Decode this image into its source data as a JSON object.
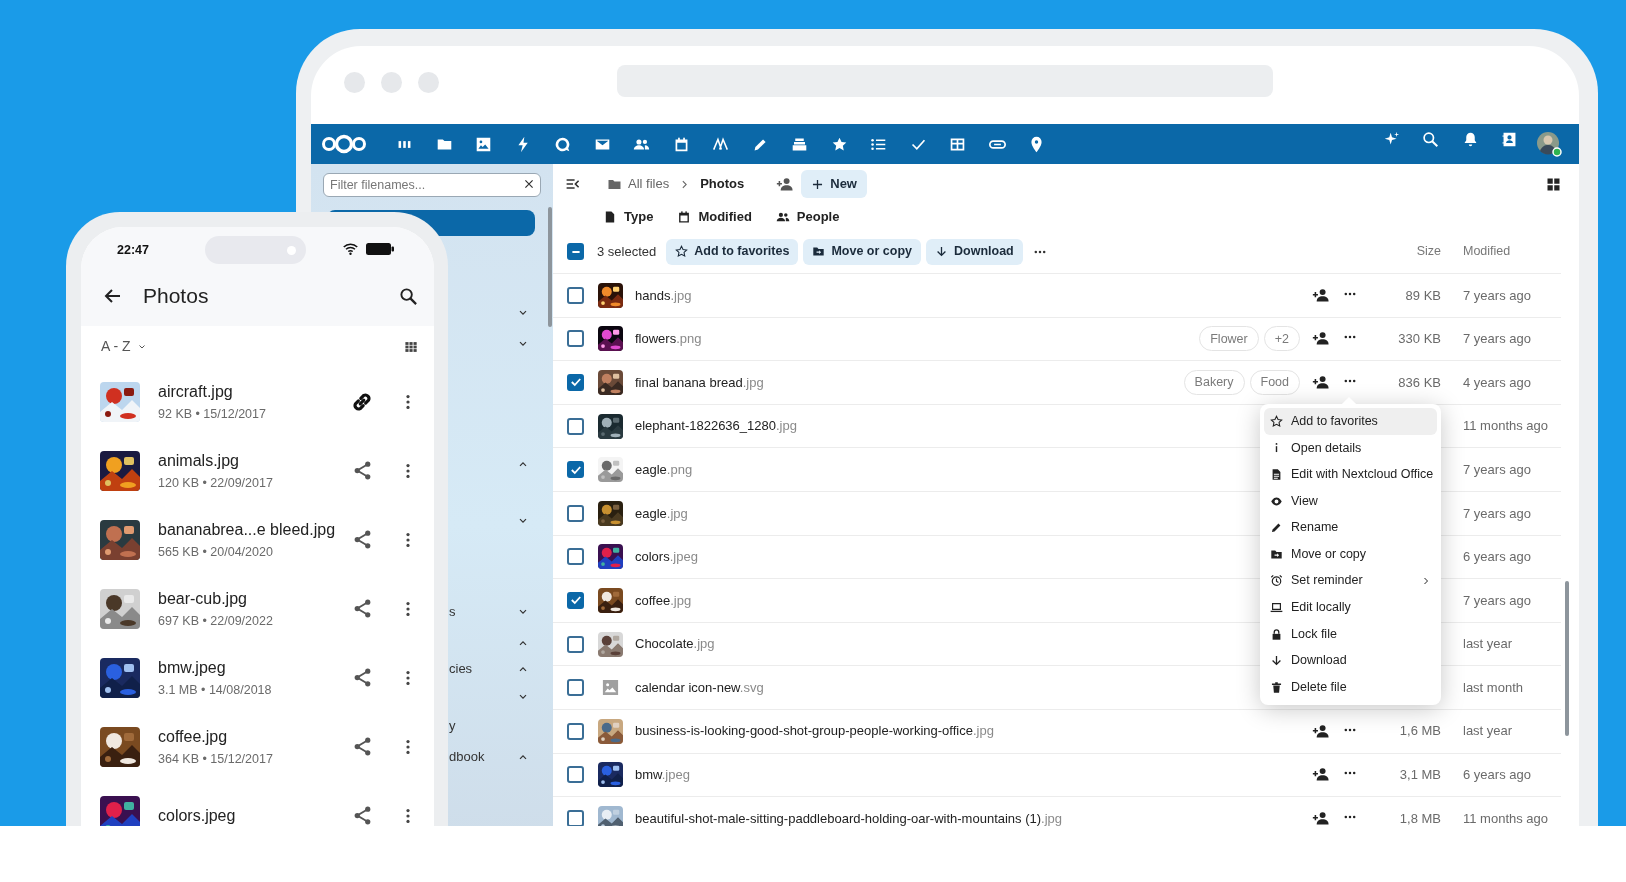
{
  "tablet": {
    "sidebar": {
      "filter_placeholder": "Filter filenames...",
      "items": [
        {
          "selected": true
        },
        {
          "selected": false,
          "expanded": false
        },
        {
          "selected": false,
          "expanded": false
        },
        {
          "selected": false,
          "expanded": true
        },
        {
          "selected": false,
          "expanded": false
        },
        {
          "selected": false,
          "label": "s",
          "expanded": false
        },
        {
          "selected": false,
          "expanded": true
        },
        {
          "selected": false,
          "label": "cies",
          "expanded": true
        },
        {
          "selected": false,
          "expanded": false
        },
        {
          "selected": false,
          "label": "y"
        },
        {
          "selected": false,
          "label": "dbook",
          "expanded": true
        }
      ]
    },
    "breadcrumb": [
      "All files",
      "Photos"
    ],
    "new_button": "New",
    "filters": [
      "Type",
      "Modified",
      "People"
    ],
    "selection": {
      "label": "3 selected",
      "indeterminate": true
    },
    "bulk_actions": [
      "Add to favorites",
      "Move or copy",
      "Download"
    ],
    "columns": [
      "Size",
      "Modified"
    ],
    "rows": [
      {
        "name": "hands.jpg",
        "checked": false,
        "actions": true,
        "size": "89 KB",
        "modified": "7 years ago"
      },
      {
        "name": "flowers.png",
        "checked": false,
        "tags": [
          "Flower",
          "+2"
        ],
        "actions": true,
        "size": "330 KB",
        "modified": "7 years ago"
      },
      {
        "name": "final banana bread.jpg",
        "checked": true,
        "tags": [
          "Bakery",
          "Food"
        ],
        "actions": true,
        "size": "836 KB",
        "modified": "4 years ago"
      },
      {
        "name": "elephant-1822636_1280.jpg",
        "checked": false,
        "actions": false,
        "modified": "11 months ago"
      },
      {
        "name": "eagle.png",
        "checked": true,
        "actions": false,
        "modified": "7 years ago"
      },
      {
        "name": "eagle.jpg",
        "checked": false,
        "actions": false,
        "modified": "7 years ago"
      },
      {
        "name": "colors.jpeg",
        "checked": false,
        "actions": false,
        "modified": "6 years ago"
      },
      {
        "name": "coffee.jpg",
        "checked": true,
        "actions": false,
        "modified": "7 years ago"
      },
      {
        "name": "Chocolate.jpg",
        "checked": false,
        "actions": false,
        "modified": "last year"
      },
      {
        "kind": "placeholder",
        "name": "calendar icon-new.svg",
        "checked": false,
        "actions": false,
        "modified": "last month"
      },
      {
        "name": "business-is-looking-good-shot-group-people-working-office.jpg",
        "checked": false,
        "actions": true,
        "size": "1,6 MB",
        "modified": "last year"
      },
      {
        "name": "bmw.jpeg",
        "checked": false,
        "actions": true,
        "size": "3,1 MB",
        "modified": "6 years ago"
      },
      {
        "name": "beautiful-shot-male-sitting-paddleboard-holding-oar-with-mountains (1).jpg",
        "checked": false,
        "actions": true,
        "size": "1,8 MB",
        "modified": "11 months ago"
      }
    ],
    "context_menu": [
      {
        "label": "Add to favorites",
        "highlighted": true
      },
      {
        "label": "Open details",
        "highlighted": false
      },
      {
        "label": "Edit with Nextcloud Office",
        "highlighted": false
      },
      {
        "label": "View",
        "highlighted": false
      },
      {
        "label": "Rename",
        "highlighted": false
      },
      {
        "label": "Move or copy",
        "highlighted": false
      },
      {
        "label": "Set reminder",
        "highlighted": false,
        "submenu": true
      },
      {
        "label": "Edit locally",
        "highlighted": false
      },
      {
        "label": "Lock file",
        "highlighted": false
      },
      {
        "label": "Download",
        "highlighted": false
      },
      {
        "label": "Delete file",
        "highlighted": false
      }
    ]
  },
  "phone": {
    "time": "22:47",
    "title": "Photos",
    "sort": "A - Z",
    "items": [
      {
        "kind": "link",
        "name": "aircraft.jpg",
        "details": "92 KB • 15/12/2017"
      },
      {
        "kind": "share",
        "name": "animals.jpg",
        "details": "120 KB • 22/09/2017"
      },
      {
        "kind": "share",
        "name": "bananabrea...e bleed.jpg",
        "details": "565 KB • 20/04/2020"
      },
      {
        "kind": "share",
        "name": "bear-cub.jpg",
        "details": "697 KB • 22/09/2022"
      },
      {
        "kind": "share",
        "name": "bmw.jpeg",
        "details": "3.1 MB • 14/08/2018"
      },
      {
        "kind": "share",
        "name": "coffee.jpg",
        "details": "364 KB • 15/12/2017"
      },
      {
        "kind": "share",
        "name": "colors.jpeg"
      }
    ]
  }
}
